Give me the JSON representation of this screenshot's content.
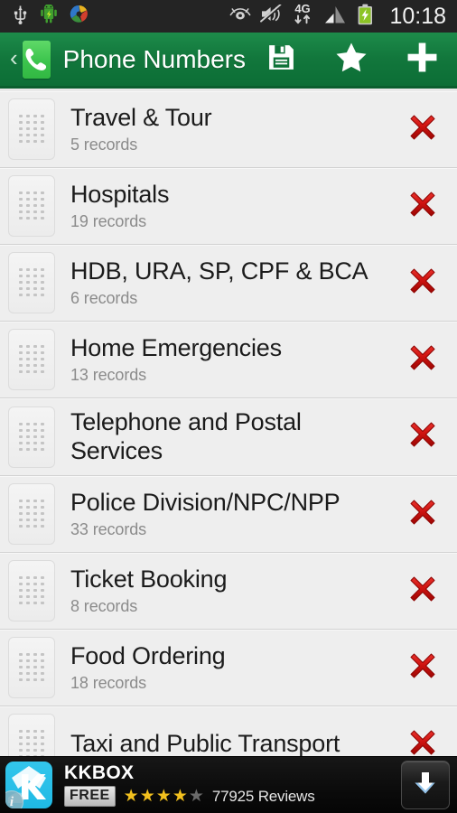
{
  "status_bar": {
    "time": "10:18",
    "network": "4G",
    "left_icons": [
      "usb-icon",
      "android-system-update-icon",
      "app-sync-icon"
    ],
    "right_icons": [
      "eye-icon",
      "sound-muted-icon",
      "4g-data-icon",
      "signal-bars-icon",
      "battery-charging-icon"
    ]
  },
  "action_bar": {
    "back_label": "‹",
    "app_icon": "phone-handset-icon",
    "title": "Phone Numbers",
    "actions": [
      {
        "name": "save-button",
        "icon": "floppy-disk-icon"
      },
      {
        "name": "favorites-button",
        "icon": "star-icon"
      },
      {
        "name": "add-button",
        "icon": "plus-icon"
      }
    ]
  },
  "list": {
    "items": [
      {
        "title": "Travel & Tour",
        "records": "5 records",
        "wrap": false
      },
      {
        "title": "Hospitals",
        "records": "19 records",
        "wrap": false
      },
      {
        "title": "HDB, URA, SP, CPF & BCA",
        "records": "6 records",
        "wrap": false
      },
      {
        "title": "Home Emergencies",
        "records": "13 records",
        "wrap": false
      },
      {
        "title": "Telephone and Postal Services",
        "records": "",
        "wrap": true
      },
      {
        "title": "Police Division/NPC/NPP",
        "records": "33 records",
        "wrap": false
      },
      {
        "title": "Ticket Booking",
        "records": "8 records",
        "wrap": false
      },
      {
        "title": "Food Ordering",
        "records": "18 records",
        "wrap": false
      },
      {
        "title": "Taxi and Public Transport",
        "records": "",
        "wrap": false
      }
    ]
  },
  "ad_banner": {
    "app_name": "KKBOX",
    "price_badge": "FREE",
    "rating_filled": 4,
    "rating_total": 5,
    "reviews": "77925 Reviews",
    "info_glyph": "i",
    "download_icon": "download-arrow-icon"
  },
  "colors": {
    "action_bar_green": "#12773c",
    "app_icon_green": "#3cc44d",
    "delete_red": "#c8120f",
    "row_bg": "#eeeeee",
    "ad_accent_cyan": "#29bfe8",
    "star_gold": "#f2c01e"
  }
}
